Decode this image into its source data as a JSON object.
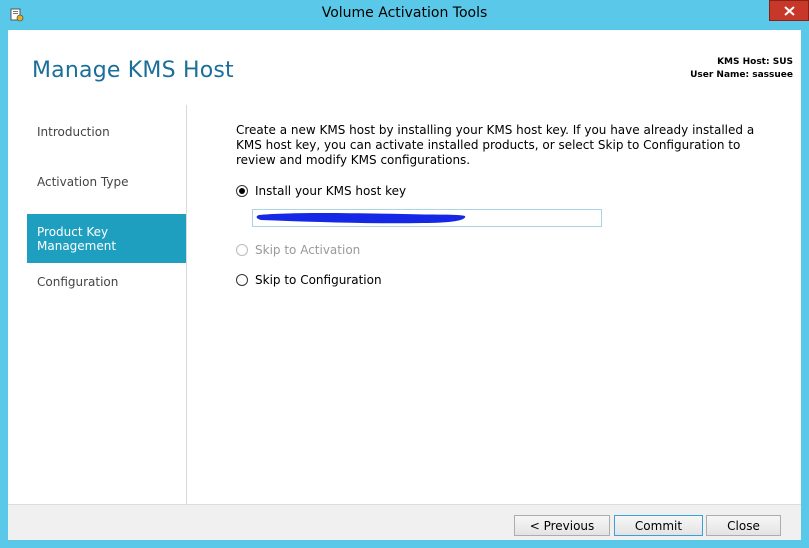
{
  "window": {
    "title": "Volume Activation Tools"
  },
  "header": {
    "page_title": "Manage KMS Host",
    "kms_host_label": "KMS Host: SUS",
    "user_name_label": "User Name: sassuee"
  },
  "sidebar": {
    "items": [
      {
        "label": "Introduction",
        "active": false
      },
      {
        "label": "Activation Type",
        "active": false
      },
      {
        "label": "Product Key Management",
        "active": true
      },
      {
        "label": "Configuration",
        "active": false
      }
    ]
  },
  "main": {
    "intro": "Create a new KMS host by installing your KMS host key. If you have already installed a KMS host key, you can activate installed products, or select Skip to Configuration to review and modify KMS configurations.",
    "options": [
      {
        "label": "Install your KMS host key",
        "checked": true,
        "disabled": false
      },
      {
        "label": "Skip to Activation",
        "checked": false,
        "disabled": true
      },
      {
        "label": "Skip to Configuration",
        "checked": false,
        "disabled": false
      }
    ],
    "key_input_value": ""
  },
  "footer": {
    "previous_label": "< Previous",
    "commit_label": "Commit",
    "close_label": "Close"
  },
  "colors": {
    "titlebar": "#5ac8e8",
    "accent": "#1e9fbf",
    "title_text": "#1a6f9a",
    "close": "#c7372a",
    "redaction": "#1428e6"
  }
}
